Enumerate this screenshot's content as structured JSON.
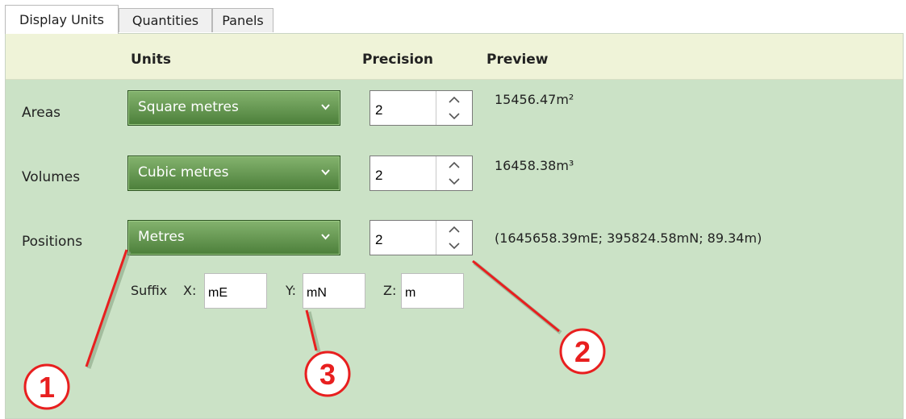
{
  "tabs": [
    "Display Units",
    "Quantities",
    "Panels"
  ],
  "headers": {
    "units": "Units",
    "precision": "Precision",
    "preview": "Preview"
  },
  "rows": [
    {
      "label": "Areas",
      "unit": "Square metres",
      "precision": "2",
      "preview": "15456.47m²"
    },
    {
      "label": "Volumes",
      "unit": "Cubic metres",
      "precision": "2",
      "preview": "16458.38m³"
    },
    {
      "label": "Positions",
      "unit": "Metres",
      "precision": "2",
      "preview": "(1645658.39mE; 395824.58mN; 89.34m)"
    }
  ],
  "suffix": {
    "label": "Suffix",
    "x_label": "X:",
    "x_value": "mE",
    "y_label": "Y:",
    "y_value": "mN",
    "z_label": "Z:",
    "z_value": "m"
  },
  "callouts": [
    "1",
    "2",
    "3"
  ],
  "colors": {
    "panel_bg": "#cbe2c6",
    "header_bg": "#eff3d8",
    "dropdown_green": "#4c7f3a",
    "callout_red": "#e81f1f"
  },
  "icons": {
    "dropdown": "chevron-down-icon",
    "spin_up": "chevron-up-icon",
    "spin_down": "chevron-down-icon"
  }
}
